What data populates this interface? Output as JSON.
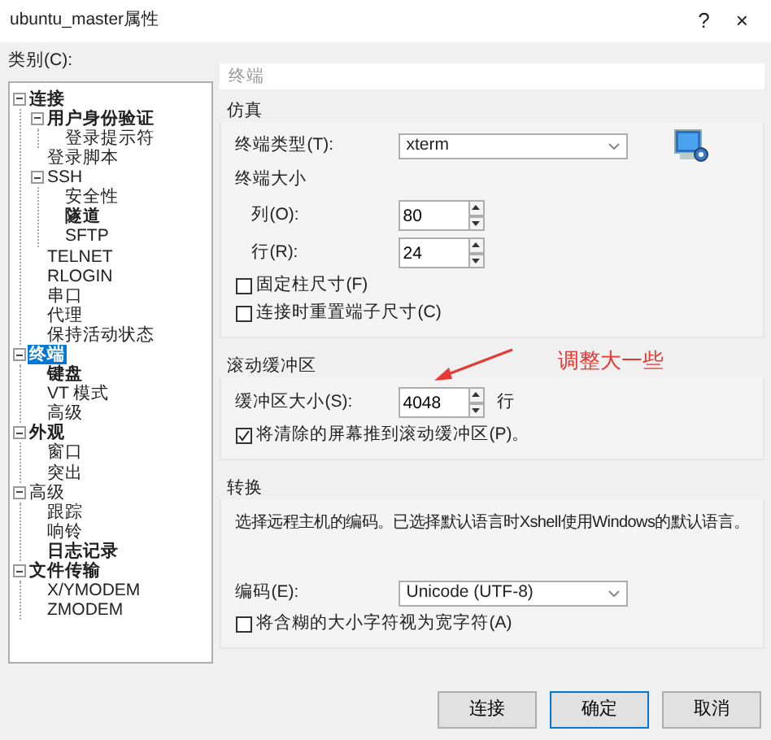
{
  "window": {
    "title": "ubuntu_master属性",
    "buttons": [
      "?",
      "×"
    ]
  },
  "category_label": "类别(C):",
  "tree": [
    {
      "label": "连接",
      "bold": true,
      "selected": false,
      "expanded": true,
      "children": [
        {
          "label": "用户身份验证",
          "bold": true,
          "selected": false,
          "expanded": true,
          "children": [
            {
              "label": "登录提示符",
              "bold": false,
              "selected": false
            }
          ]
        },
        {
          "label": "登录脚本",
          "bold": false,
          "selected": false
        },
        {
          "label": "SSH",
          "bold": false,
          "selected": false,
          "expanded": true,
          "children": [
            {
              "label": "安全性",
              "bold": false,
              "selected": false
            },
            {
              "label": "隧道",
              "bold": true,
              "selected": false
            },
            {
              "label": "SFTP",
              "bold": false,
              "selected": false
            }
          ]
        },
        {
          "label": "TELNET",
          "bold": false,
          "selected": false
        },
        {
          "label": "RLOGIN",
          "bold": false,
          "selected": false
        },
        {
          "label": "串口",
          "bold": false,
          "selected": false
        },
        {
          "label": "代理",
          "bold": false,
          "selected": false
        },
        {
          "label": "保持活动状态",
          "bold": false,
          "selected": false
        }
      ]
    },
    {
      "label": "终端",
      "bold": true,
      "selected": true,
      "expanded": true,
      "children": [
        {
          "label": "键盘",
          "bold": true,
          "selected": false
        },
        {
          "label": "VT 模式",
          "bold": false,
          "selected": false
        },
        {
          "label": "高级",
          "bold": false,
          "selected": false
        }
      ]
    },
    {
      "label": "外观",
      "bold": true,
      "selected": false,
      "expanded": true,
      "children": [
        {
          "label": "窗口",
          "bold": false,
          "selected": false
        },
        {
          "label": "突出",
          "bold": false,
          "selected": false
        }
      ]
    },
    {
      "label": "高级",
      "bold": false,
      "selected": false,
      "expanded": true,
      "children": [
        {
          "label": "跟踪",
          "bold": false,
          "selected": false
        },
        {
          "label": "响铃",
          "bold": false,
          "selected": false
        },
        {
          "label": "日志记录",
          "bold": true,
          "selected": false
        }
      ]
    },
    {
      "label": "文件传输",
      "bold": true,
      "selected": false,
      "expanded": true,
      "children": [
        {
          "label": "X/YMODEM",
          "bold": false,
          "selected": false
        },
        {
          "label": "ZMODEM",
          "bold": false,
          "selected": false
        }
      ]
    }
  ],
  "panel": {
    "title": "终端",
    "groups": [
      {
        "title": "仿真",
        "rows": [
          {
            "kind": "select",
            "label": "终端类型(T):",
            "value": "xterm"
          },
          {
            "kind": "heading",
            "label": "终端大小",
            "children": [
              {
                "kind": "spin",
                "label": "列(O):",
                "value": "80"
              },
              {
                "kind": "spin",
                "label": "行(R):",
                "value": "24"
              }
            ]
          },
          {
            "kind": "checkbox",
            "label": "固定柱尺寸(F)",
            "checked": false
          },
          {
            "kind": "checkbox",
            "label": "连接时重置端子尺寸(C)",
            "checked": false
          }
        ]
      },
      {
        "title": "滚动缓冲区",
        "rows": [
          {
            "kind": "spin",
            "label": "缓冲区大小(S):",
            "value": "4048",
            "unit": "行"
          },
          {
            "kind": "checkbox",
            "label": "将清除的屏幕推到滚动缓冲区(P)。",
            "checked": true
          }
        ]
      },
      {
        "title": "转换",
        "rows": [
          {
            "kind": "text",
            "text": "选择远程主机的编码。已选择默认语言时Xshell使用Windows的默认语言。"
          },
          {
            "kind": "select",
            "label": "编码(E):",
            "value": "Unicode (UTF-8)"
          },
          {
            "kind": "checkbox",
            "label": "将含糊的大小字符视为宽字符(A)",
            "checked": false
          }
        ]
      }
    ]
  },
  "annotation": {
    "text": "调整大一些"
  },
  "buttons": [
    {
      "label": "连接",
      "default": false
    },
    {
      "label": "确定",
      "default": true
    },
    {
      "label": "取消",
      "default": false
    }
  ]
}
